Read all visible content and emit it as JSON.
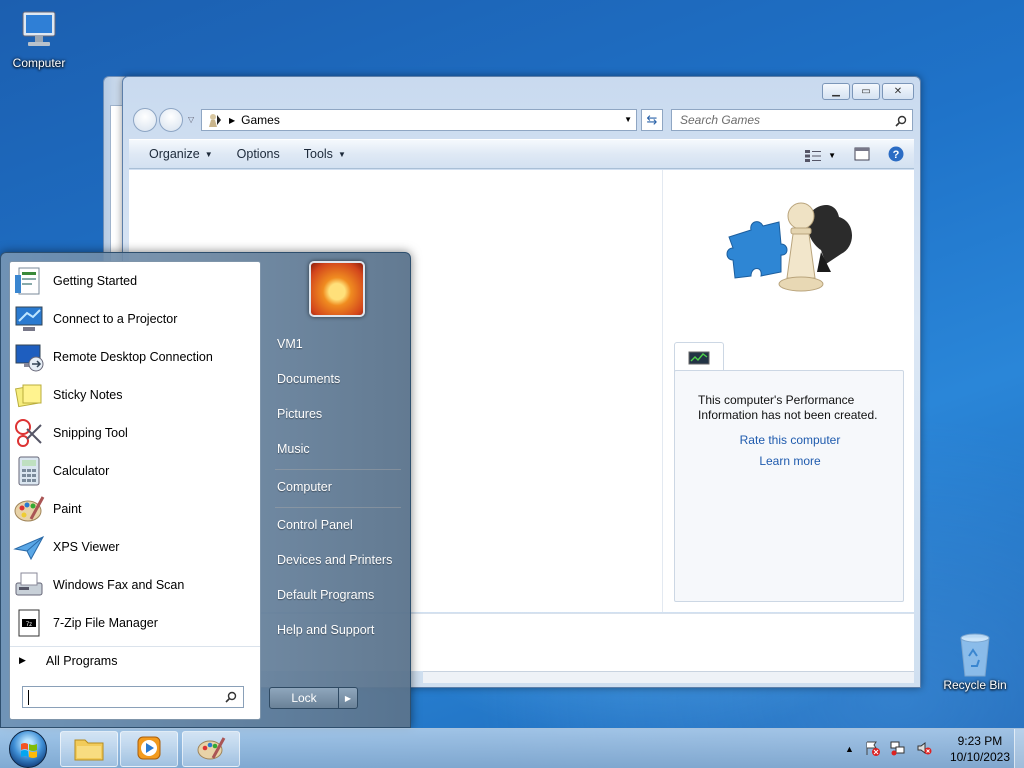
{
  "desktop": {
    "icons": [
      {
        "label": "Computer",
        "icon": "computer-icon"
      },
      {
        "label": "Recycle Bin",
        "icon": "recycle-bin-icon"
      }
    ]
  },
  "explorer": {
    "breadcrumb": "Games",
    "search_placeholder": "Search Games",
    "toolbar": {
      "organize": "Organize",
      "options": "Options",
      "tools": "Tools"
    },
    "details": {
      "performance_text": "This computer's Performance Information has not been created.",
      "rate_link": "Rate this computer",
      "learn_link": "Learn more"
    }
  },
  "start_menu": {
    "programs": [
      {
        "label": "Getting Started",
        "icon": "getting-started-icon"
      },
      {
        "label": "Connect to a Projector",
        "icon": "projector-icon"
      },
      {
        "label": "Remote Desktop Connection",
        "icon": "remote-desktop-icon"
      },
      {
        "label": "Sticky Notes",
        "icon": "sticky-notes-icon"
      },
      {
        "label": "Snipping Tool",
        "icon": "snipping-tool-icon"
      },
      {
        "label": "Calculator",
        "icon": "calculator-icon"
      },
      {
        "label": "Paint",
        "icon": "paint-icon"
      },
      {
        "label": "XPS Viewer",
        "icon": "xps-viewer-icon"
      },
      {
        "label": "Windows Fax and Scan",
        "icon": "fax-scan-icon"
      },
      {
        "label": "7-Zip File Manager",
        "icon": "7zip-icon"
      }
    ],
    "all_programs": "All Programs",
    "right_items": {
      "user": "VM1",
      "documents": "Documents",
      "pictures": "Pictures",
      "music": "Music",
      "computer": "Computer",
      "control_panel": "Control Panel",
      "devices": "Devices and Printers",
      "default_programs": "Default Programs",
      "help": "Help and Support"
    },
    "lock_label": "Lock"
  },
  "taskbar": {
    "pinned": [
      {
        "icon": "explorer-icon"
      },
      {
        "icon": "media-player-icon"
      },
      {
        "icon": "paint-icon"
      }
    ],
    "clock": {
      "time": "9:23 PM",
      "date": "10/10/2023"
    }
  }
}
